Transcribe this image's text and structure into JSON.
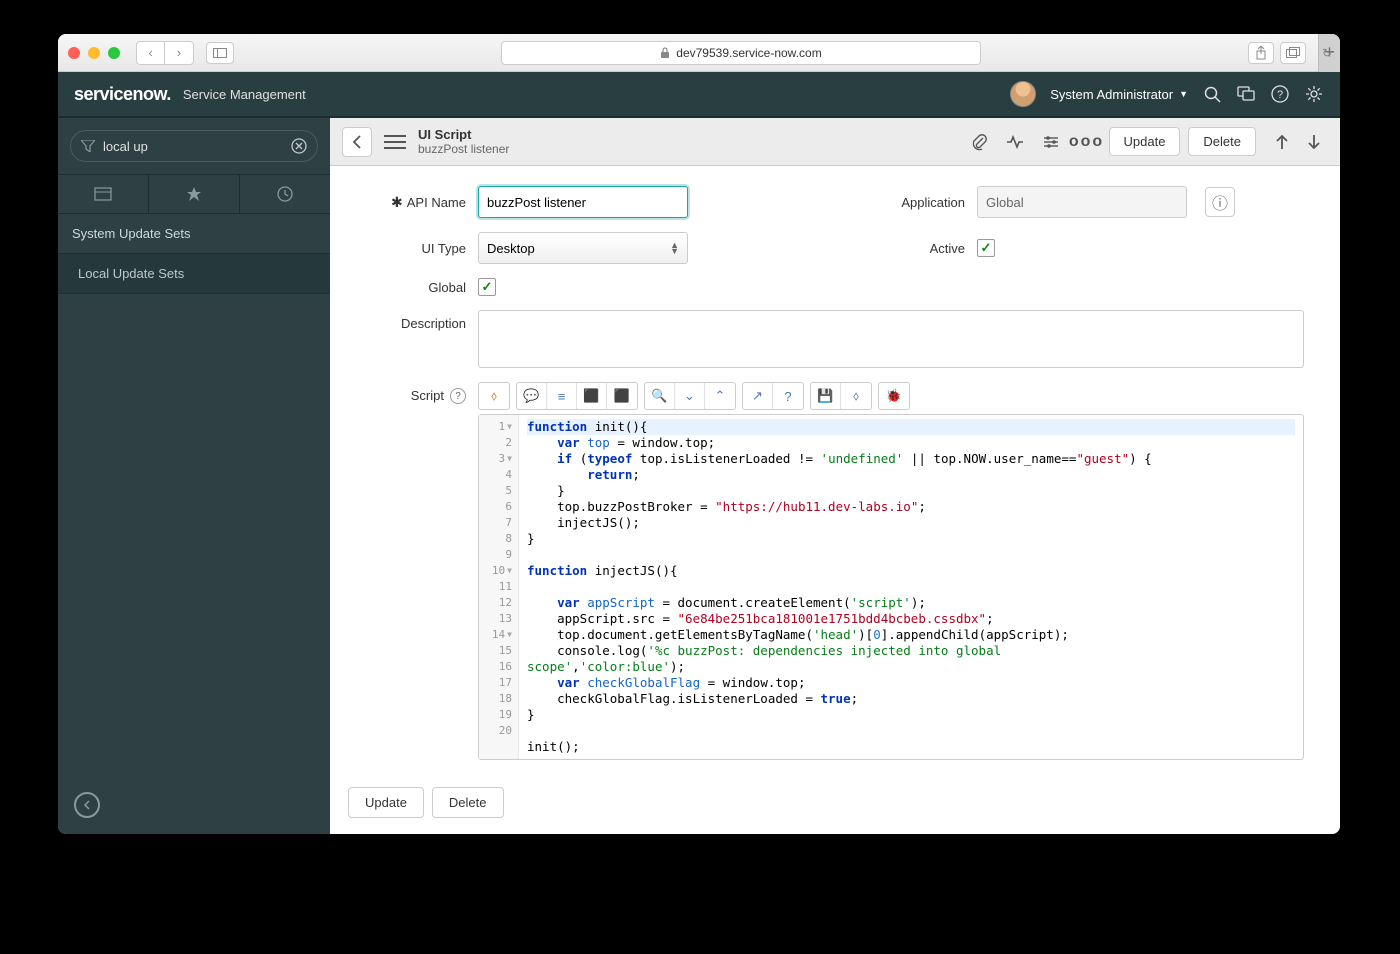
{
  "browser": {
    "url_host": "dev79539.service-now.com"
  },
  "banner": {
    "logo": "servicenow.",
    "sub": "Service Management",
    "user": "System Administrator"
  },
  "sidebar": {
    "filter_value": "local up",
    "section": "System Update Sets",
    "item": "Local Update Sets"
  },
  "header": {
    "title": "UI Script",
    "subtitle": "buzzPost listener",
    "update": "Update",
    "delete": "Delete"
  },
  "form": {
    "api_name_label": "API Name",
    "api_name_value": "buzzPost listener",
    "ui_type_label": "UI Type",
    "ui_type_value": "Desktop",
    "global_label": "Global",
    "application_label": "Application",
    "application_value": "Global",
    "active_label": "Active",
    "description_label": "Description",
    "script_label": "Script"
  },
  "script": {
    "lines": [
      {
        "n": 1,
        "fold": true
      },
      {
        "n": 2
      },
      {
        "n": 3,
        "fold": true
      },
      {
        "n": 4
      },
      {
        "n": 5
      },
      {
        "n": 6
      },
      {
        "n": 7
      },
      {
        "n": 8
      },
      {
        "n": 9
      },
      {
        "n": 10,
        "fold": true
      },
      {
        "n": 11
      },
      {
        "n": 12
      },
      {
        "n": 13
      },
      {
        "n": 14,
        "fold": true
      },
      {
        "n": 15
      },
      {
        "n": 16
      },
      {
        "n": 17
      },
      {
        "n": 18
      },
      {
        "n": 19
      },
      {
        "n": 20
      }
    ],
    "code": {
      "l1": "function init(){",
      "l2_a": "var",
      "l2_b": "top",
      "l2_c": " = window.top;",
      "l3_a": "if",
      "l3_b": "(",
      "l3_c": "typeof",
      "l3_d": " top.isListenerLoaded != ",
      "l3_e": "'undefined'",
      "l3_f": " || top.NOW.user_name==",
      "l3_g": "\"guest\"",
      "l3_h": ") {",
      "l4_a": "return",
      "l4_b": ";",
      "l5": "    }",
      "l6_a": "    top.buzzPostBroker = ",
      "l6_b": "\"https://hub11.dev-labs.io\"",
      "l6_c": ";",
      "l7": "    injectJS();",
      "l8": "}",
      "l10": "function injectJS(){",
      "l12_a": "var",
      "l12_b": "appScript",
      "l12_c": " = document.createElement(",
      "l12_d": "'script'",
      "l12_e": ");",
      "l13_a": "    appScript.src = ",
      "l13_b": "\"6e84be251bca181001e1751bdd4bcbeb.cssdbx\"",
      "l13_c": ";",
      "l14_a": "    top.document.getElementsByTagName(",
      "l14_b": "'head'",
      "l14_c": ")[",
      "l14_d": "0",
      "l14_e": "].appendChild(appScript);",
      "l15_a": "    console.log(",
      "l15_b": "'%c buzzPost: dependencies injected into global",
      "l15c_a": "scope'",
      "l15c_b": ",",
      "l15c_c": "'color:blue'",
      "l15c_d": ");",
      "l16_a": "var",
      "l16_b": "checkGlobalFlag",
      "l16_c": " = window.top;",
      "l17_a": "    checkGlobalFlag.isListenerLoaded = ",
      "l17_b": "true",
      "l17_c": ";",
      "l18": "}",
      "l20": "init();"
    }
  },
  "bottom": {
    "update": "Update",
    "delete": "Delete"
  }
}
